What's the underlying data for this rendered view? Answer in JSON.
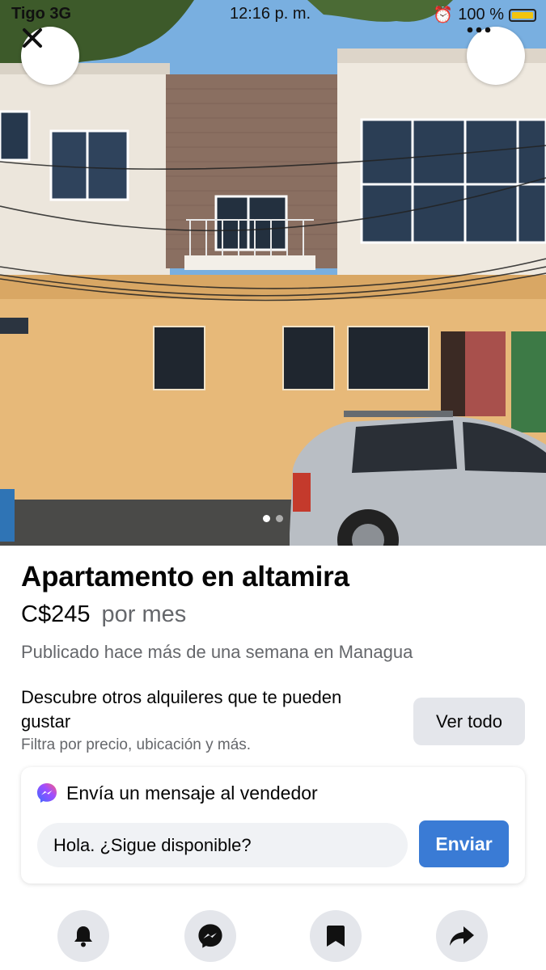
{
  "status_bar": {
    "carrier": "Tigo 3G",
    "time": "12:16 p. m.",
    "battery": "100 %"
  },
  "photo": {
    "alt": "Apartamento en altamira",
    "carousel_count": 2,
    "active_index": 0
  },
  "listing": {
    "title": "Apartamento en altamira",
    "price": "C$245",
    "price_unit": "por mes",
    "posted": "Publicado hace más de una semana en Managua"
  },
  "discover": {
    "title": "Descubre otros alquileres que te pueden gustar",
    "subtitle": "Filtra por precio, ubicación y más.",
    "button_label": "Ver todo"
  },
  "message": {
    "heading": "Envía un mensaje al vendedor",
    "input_value": "Hola. ¿Sigue disponible?",
    "send_label": "Enviar"
  },
  "actions": [
    {
      "icon": "bell-icon"
    },
    {
      "icon": "messenger-icon"
    },
    {
      "icon": "bookmark-icon"
    },
    {
      "icon": "share-icon"
    }
  ],
  "colors": {
    "accent": "#3a7bd5",
    "secondary_text": "#65676b",
    "button_gray": "#e4e6eb"
  }
}
